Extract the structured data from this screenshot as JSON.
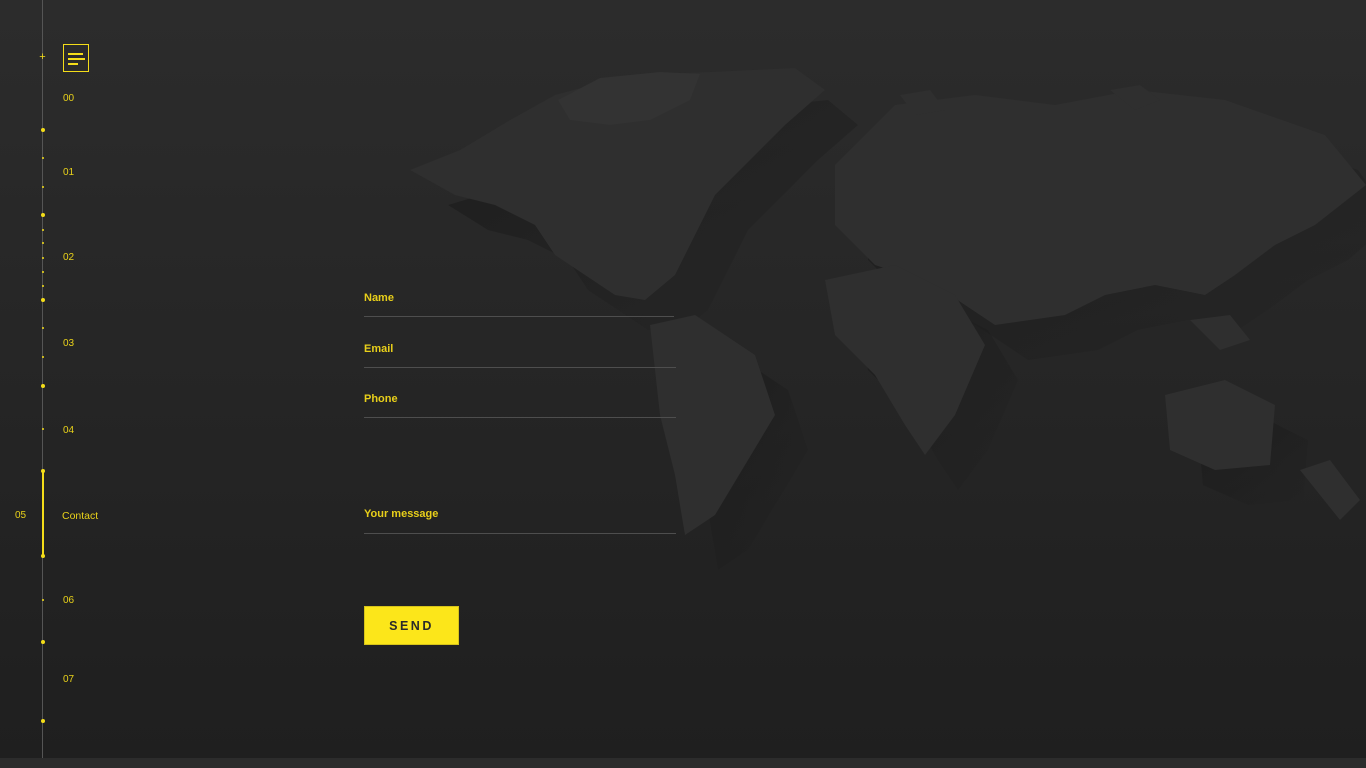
{
  "nav": {
    "items": [
      {
        "num": "00"
      },
      {
        "num": "01"
      },
      {
        "num": "02"
      },
      {
        "num": "03"
      },
      {
        "num": "04"
      },
      {
        "num": "05",
        "label": "Contact",
        "active": true
      },
      {
        "num": "06"
      },
      {
        "num": "07"
      }
    ]
  },
  "menu_icon": "menu-icon",
  "form": {
    "name_label": "Name",
    "email_label": "Email",
    "phone_label": "Phone",
    "message_label": "Your message",
    "send_label": "SEND"
  },
  "colors": {
    "accent": "#f4dd19",
    "background": "#262626",
    "map": "#2f2f2f"
  }
}
